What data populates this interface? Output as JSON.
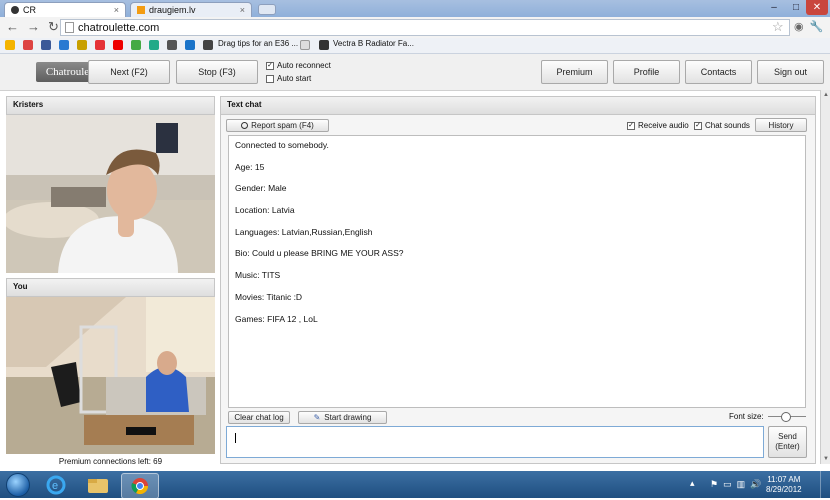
{
  "browser": {
    "tabs": [
      {
        "title": "CR",
        "active": true
      },
      {
        "title": "draugiem.lv",
        "active": false
      }
    ],
    "address": "chatroulette.com",
    "bookmarks": [
      "Drag tips for an E36 ...",
      "Vectra B Radiator Fa..."
    ]
  },
  "header": {
    "logo": "Chatroulette",
    "next_label": "Next (F2)",
    "stop_label": "Stop (F3)",
    "auto_reconnect_label": "Auto reconnect",
    "auto_reconnect_checked": true,
    "auto_start_label": "Auto start",
    "auto_start_checked": false,
    "premium_label": "Premium",
    "profile_label": "Profile",
    "contacts_label": "Contacts",
    "signout_label": "Sign out"
  },
  "partner": {
    "name": "Kristers"
  },
  "self": {
    "name": "You",
    "premium_text": "Premium connections left: 69"
  },
  "chat": {
    "title": "Text chat",
    "report_label": "Report spam (F4)",
    "receive_audio_label": "Receive audio",
    "receive_audio_checked": true,
    "chat_sounds_label": "Chat sounds",
    "chat_sounds_checked": true,
    "history_label": "History",
    "log": [
      "Connected to somebody.",
      "Age: 15",
      "Gender: Male",
      "Location: Latvia",
      "Languages: Latvian,Russian,English",
      "Bio: Could u please BRING ME YOUR ASS?",
      "Music: TITS",
      "Movies: Titanic :D",
      "Games: FIFA 12 , LoL"
    ],
    "clear_label": "Clear chat log",
    "draw_label": "Start drawing",
    "font_size_label": "Font size:",
    "input_value": "",
    "send_label": "Send\n(Enter)"
  },
  "taskbar": {
    "time": "11:07 AM",
    "date": "8/29/2012"
  },
  "colors": {
    "accent_blue": "#1f4f80",
    "logo_bg": "#6e6e6e"
  }
}
